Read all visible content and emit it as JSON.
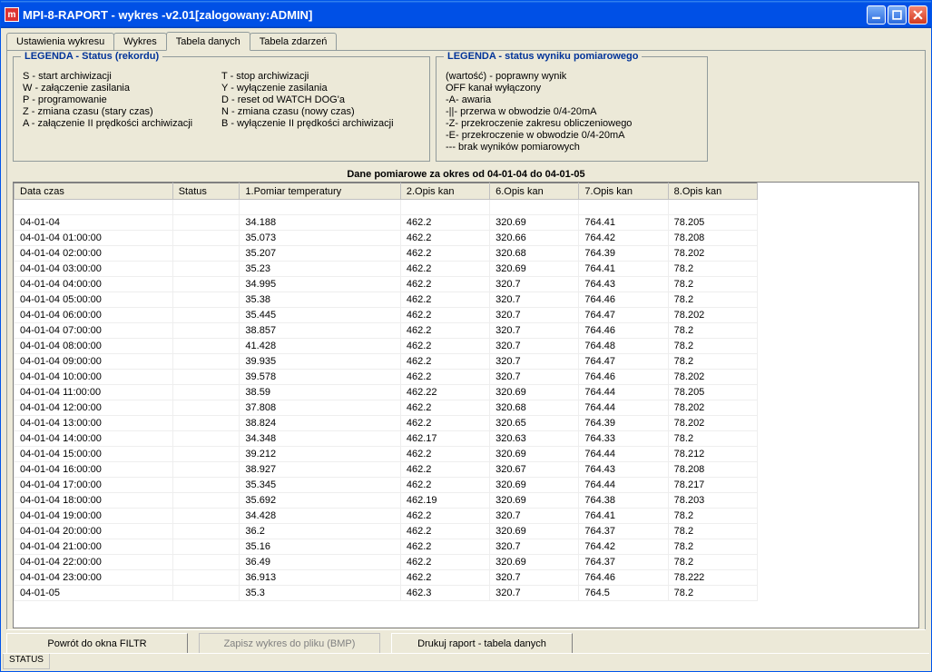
{
  "window": {
    "title": "MPI-8-RAPORT - wykres -v2.01[zalogowany:ADMIN]",
    "appicon_letter": "m"
  },
  "tabs": {
    "items": [
      {
        "label": "Ustawienia wykresu",
        "active": false
      },
      {
        "label": "Wykres",
        "active": false
      },
      {
        "label": "Tabela danych",
        "active": true
      },
      {
        "label": "Tabela zdarzeń",
        "active": false
      }
    ]
  },
  "legend_status": {
    "title": "LEGENDA - Status (rekordu)",
    "col1": [
      "S - start archiwizacji",
      "W - załączenie zasilania",
      "P - programowanie",
      "Z - zmiana czasu (stary czas)",
      "A - załączenie II prędkości archiwizacji"
    ],
    "col2": [
      "T - stop archiwizacji",
      "Y - wyłączenie zasilania",
      "D - reset od WATCH DOG'a",
      "N - zmiana czasu (nowy czas)",
      "B - wyłączenie II prędkości archiwizacji"
    ]
  },
  "legend_meas": {
    "title": "LEGENDA - status wyniku pomiarowego",
    "lines": [
      "(wartość) - poprawny wynik",
      "OFF   kanał wyłączony",
      "-A-   awaria",
      "-||-   przerwa w obwodzie 0/4-20mA",
      "-Z-   przekroczenie zakresu obliczeniowego",
      "-E-   przekroczenie w obwodzie 0/4-20mA",
      "---   brak wyników pomiarowych"
    ]
  },
  "table_title": "Dane pomiarowe za okres od 04-01-04 do 04-01-05",
  "columns": [
    {
      "key": "date",
      "label": "Data czas",
      "cls": "col-date"
    },
    {
      "key": "status",
      "label": "Status",
      "cls": "col-status"
    },
    {
      "key": "v1",
      "label": "1.Pomiar temperatury",
      "cls": "col-v1"
    },
    {
      "key": "v2",
      "label": "2.Opis kan",
      "cls": "col-v2"
    },
    {
      "key": "v6",
      "label": "6.Opis kan",
      "cls": "col-v6"
    },
    {
      "key": "v7",
      "label": "7.Opis kan",
      "cls": "col-v7"
    },
    {
      "key": "v8",
      "label": "8.Opis kan",
      "cls": "col-v8"
    }
  ],
  "rows": [
    {
      "date": "",
      "status": "",
      "v1": "",
      "v2": "",
      "v6": "",
      "v7": "",
      "v8": ""
    },
    {
      "date": "04-01-04",
      "status": "",
      "v1": "34.188",
      "v2": "462.2",
      "v6": "320.69",
      "v7": "764.41",
      "v8": "78.205"
    },
    {
      "date": "04-01-04 01:00:00",
      "status": "",
      "v1": "35.073",
      "v2": "462.2",
      "v6": "320.66",
      "v7": "764.42",
      "v8": "78.208"
    },
    {
      "date": "04-01-04 02:00:00",
      "status": "",
      "v1": "35.207",
      "v2": "462.2",
      "v6": "320.68",
      "v7": "764.39",
      "v8": "78.202"
    },
    {
      "date": "04-01-04 03:00:00",
      "status": "",
      "v1": "35.23",
      "v2": "462.2",
      "v6": "320.69",
      "v7": "764.41",
      "v8": "78.2"
    },
    {
      "date": "04-01-04 04:00:00",
      "status": "",
      "v1": "34.995",
      "v2": "462.2",
      "v6": "320.7",
      "v7": "764.43",
      "v8": "78.2"
    },
    {
      "date": "04-01-04 05:00:00",
      "status": "",
      "v1": "35.38",
      "v2": "462.2",
      "v6": "320.7",
      "v7": "764.46",
      "v8": "78.2"
    },
    {
      "date": "04-01-04 06:00:00",
      "status": "",
      "v1": "35.445",
      "v2": "462.2",
      "v6": "320.7",
      "v7": "764.47",
      "v8": "78.202"
    },
    {
      "date": "04-01-04 07:00:00",
      "status": "",
      "v1": "38.857",
      "v2": "462.2",
      "v6": "320.7",
      "v7": "764.46",
      "v8": "78.2"
    },
    {
      "date": "04-01-04 08:00:00",
      "status": "",
      "v1": "41.428",
      "v2": "462.2",
      "v6": "320.7",
      "v7": "764.48",
      "v8": "78.2"
    },
    {
      "date": "04-01-04 09:00:00",
      "status": "",
      "v1": "39.935",
      "v2": "462.2",
      "v6": "320.7",
      "v7": "764.47",
      "v8": "78.2"
    },
    {
      "date": "04-01-04 10:00:00",
      "status": "",
      "v1": "39.578",
      "v2": "462.2",
      "v6": "320.7",
      "v7": "764.46",
      "v8": "78.202"
    },
    {
      "date": "04-01-04 11:00:00",
      "status": "",
      "v1": "38.59",
      "v2": "462.22",
      "v6": "320.69",
      "v7": "764.44",
      "v8": "78.205"
    },
    {
      "date": "04-01-04 12:00:00",
      "status": "",
      "v1": "37.808",
      "v2": "462.2",
      "v6": "320.68",
      "v7": "764.44",
      "v8": "78.202"
    },
    {
      "date": "04-01-04 13:00:00",
      "status": "",
      "v1": "38.824",
      "v2": "462.2",
      "v6": "320.65",
      "v7": "764.39",
      "v8": "78.202"
    },
    {
      "date": "04-01-04 14:00:00",
      "status": "",
      "v1": "34.348",
      "v2": "462.17",
      "v6": "320.63",
      "v7": "764.33",
      "v8": "78.2"
    },
    {
      "date": "04-01-04 15:00:00",
      "status": "",
      "v1": "39.212",
      "v2": "462.2",
      "v6": "320.69",
      "v7": "764.44",
      "v8": "78.212"
    },
    {
      "date": "04-01-04 16:00:00",
      "status": "",
      "v1": "38.927",
      "v2": "462.2",
      "v6": "320.67",
      "v7": "764.43",
      "v8": "78.208"
    },
    {
      "date": "04-01-04 17:00:00",
      "status": "",
      "v1": "35.345",
      "v2": "462.2",
      "v6": "320.69",
      "v7": "764.44",
      "v8": "78.217"
    },
    {
      "date": "04-01-04 18:00:00",
      "status": "",
      "v1": "35.692",
      "v2": "462.19",
      "v6": "320.69",
      "v7": "764.38",
      "v8": "78.203"
    },
    {
      "date": "04-01-04 19:00:00",
      "status": "",
      "v1": "34.428",
      "v2": "462.2",
      "v6": "320.7",
      "v7": "764.41",
      "v8": "78.2"
    },
    {
      "date": "04-01-04 20:00:00",
      "status": "",
      "v1": "36.2",
      "v2": "462.2",
      "v6": "320.69",
      "v7": "764.37",
      "v8": "78.2"
    },
    {
      "date": "04-01-04 21:00:00",
      "status": "",
      "v1": "35.16",
      "v2": "462.2",
      "v6": "320.7",
      "v7": "764.42",
      "v8": "78.2"
    },
    {
      "date": "04-01-04 22:00:00",
      "status": "",
      "v1": "36.49",
      "v2": "462.2",
      "v6": "320.69",
      "v7": "764.37",
      "v8": "78.2"
    },
    {
      "date": "04-01-04 23:00:00",
      "status": "",
      "v1": "36.913",
      "v2": "462.2",
      "v6": "320.7",
      "v7": "764.46",
      "v8": "78.222"
    },
    {
      "date": "04-01-05",
      "status": "",
      "v1": "35.3",
      "v2": "462.3",
      "v6": "320.7",
      "v7": "764.5",
      "v8": "78.2"
    }
  ],
  "buttons": {
    "back": "Powrót do okna FILTR",
    "save_bmp": "Zapisz wykres do pliku (BMP)",
    "print": "Drukuj raport - tabela danych"
  },
  "status_text": "STATUS"
}
